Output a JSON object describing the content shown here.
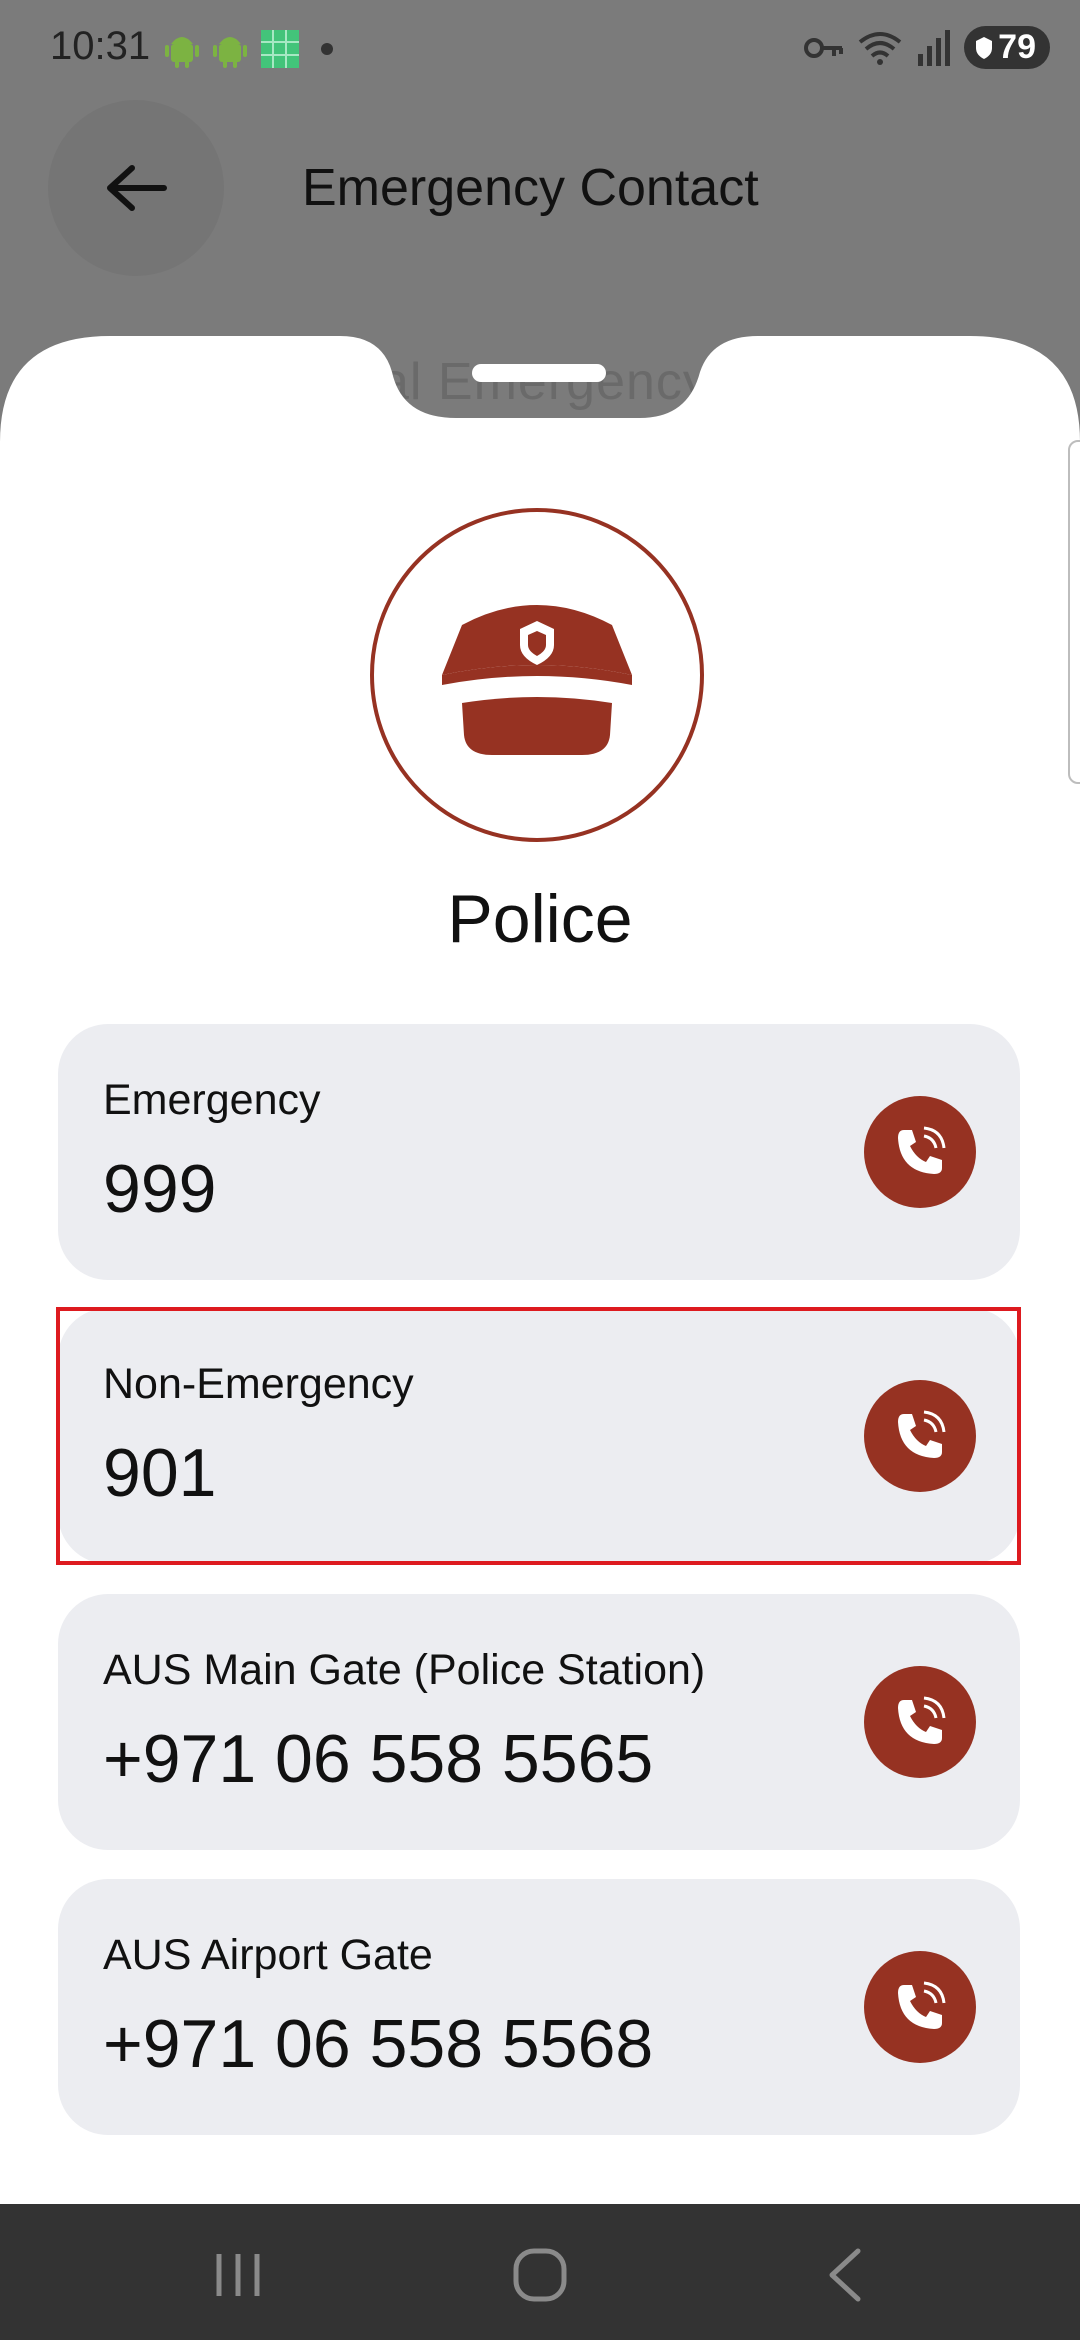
{
  "status_bar": {
    "time": "10:31",
    "battery": "79"
  },
  "header": {
    "title": "Emergency Contact",
    "peek_text": "al Emergency S"
  },
  "category": {
    "title": "Police"
  },
  "contacts": [
    {
      "label": "Emergency",
      "number": "999"
    },
    {
      "label": "Non-Emergency",
      "number": "901"
    },
    {
      "label": "AUS Main Gate (Police Station)",
      "number": "+971 06 558 5565"
    },
    {
      "label": "AUS Airport Gate",
      "number": "+971 06 558 5568"
    }
  ],
  "colors": {
    "accent": "#963222",
    "card_bg": "#ecedf1",
    "highlight": "#dd1a1f",
    "scrim": "#7b7b7b"
  },
  "icons": [
    "arrow-left-icon",
    "police-cap-icon",
    "phone-call-icon",
    "recents-icon",
    "home-icon",
    "back-nav-icon"
  ]
}
